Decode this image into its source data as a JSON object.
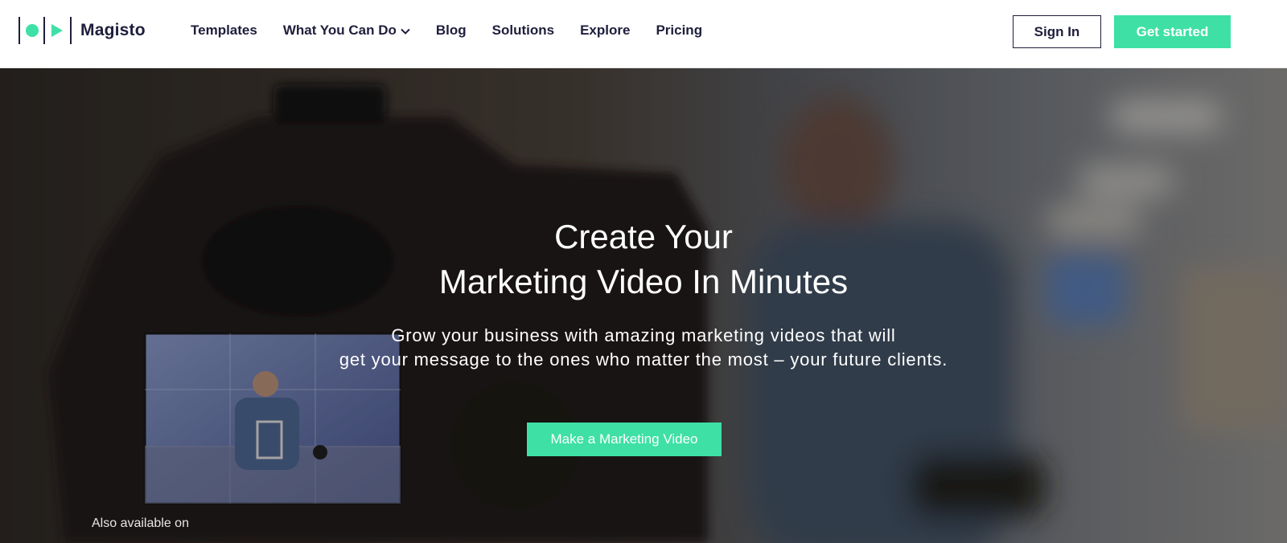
{
  "header": {
    "brand": "Magisto",
    "nav": [
      {
        "label": "Templates"
      },
      {
        "label": "What You Can Do",
        "dropdown": true
      },
      {
        "label": "Blog"
      },
      {
        "label": "Solutions"
      },
      {
        "label": "Explore"
      },
      {
        "label": "Pricing"
      }
    ],
    "sign_in": "Sign In",
    "get_started": "Get started"
  },
  "hero": {
    "title_line1": "Create Your",
    "title_line2": "Marketing Video In Minutes",
    "subtitle_line1": "Grow your business with amazing marketing videos that will",
    "subtitle_line2": "get your message to the ones who matter the most – your future clients.",
    "cta": "Make a Marketing Video",
    "also_available": "Also available on"
  },
  "colors": {
    "accent": "#3ee0a6",
    "brand_dark": "#1e1e3c"
  },
  "icons": [
    "magisto-logo-icon",
    "chevron-down-icon"
  ]
}
